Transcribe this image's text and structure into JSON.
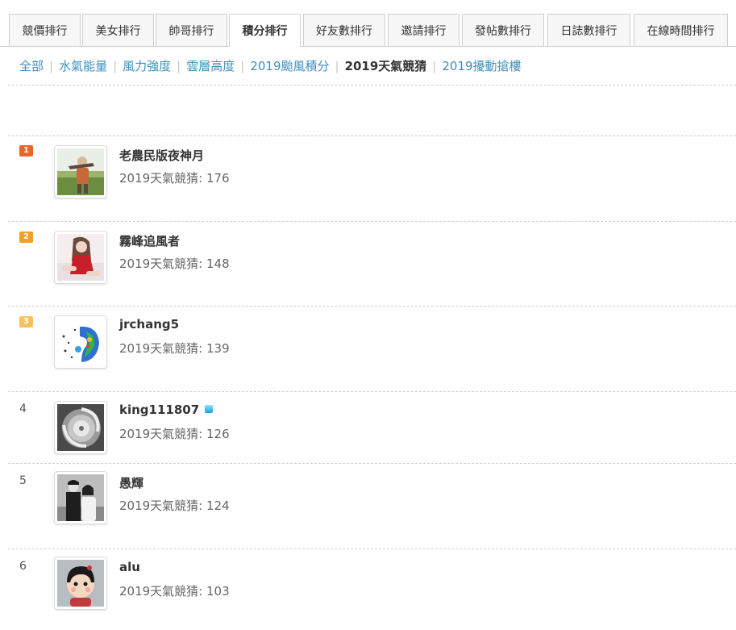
{
  "tabs": [
    {
      "label": "競價排行"
    },
    {
      "label": "美女排行"
    },
    {
      "label": "帥哥排行"
    },
    {
      "label": "積分排行"
    },
    {
      "label": "好友數排行"
    },
    {
      "label": "邀請排行"
    },
    {
      "label": "發帖數排行"
    },
    {
      "label": "日誌數排行"
    },
    {
      "label": "在線時間排行"
    }
  ],
  "active_tab": "積分排行",
  "subnav": {
    "items": [
      {
        "label": "全部"
      },
      {
        "label": "水氣能量"
      },
      {
        "label": "風力強度"
      },
      {
        "label": "雲層高度"
      },
      {
        "label": "2019颱風積分"
      },
      {
        "label": "2019天氣競猜"
      },
      {
        "label": "2019擾動搶樓"
      }
    ],
    "current": "2019天氣競猜"
  },
  "ranking": [
    {
      "rank": "1",
      "username": "老農民版夜神月",
      "score": "2019天氣競猜: 176",
      "badge_color": "#e8662b"
    },
    {
      "rank": "2",
      "username": "霧峰追風者",
      "score": "2019天氣競猜: 148",
      "badge_color": "#f0a02a"
    },
    {
      "rank": "3",
      "username": "jrchang5",
      "score": "2019天氣競猜: 139",
      "badge_color": "#f3c45e"
    },
    {
      "rank": "4",
      "username": "king111807",
      "score": "2019天氣競猜: 126",
      "badge_icon": "gem-icon"
    },
    {
      "rank": "5",
      "username": "愚輝",
      "score": "2019天氣競猜: 124"
    },
    {
      "rank": "6",
      "username": "alu",
      "score": "2019天氣競猜: 103"
    }
  ],
  "colors": {
    "link": "#3d8fbd",
    "border": "#cfcfcf",
    "text": "#333333"
  }
}
